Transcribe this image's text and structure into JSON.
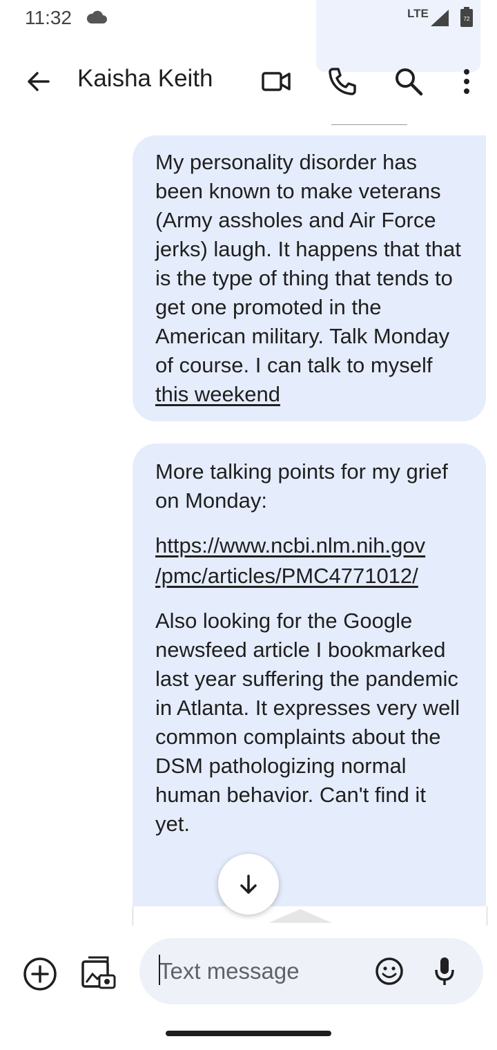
{
  "status_bar": {
    "time": "11:32",
    "network": "LTE",
    "battery_level": "72",
    "icons": [
      "cloud-icon",
      "signal-icon",
      "battery-icon"
    ]
  },
  "header": {
    "contact_name": "Kaisha Keith",
    "icons": [
      "back-arrow-icon",
      "video-call-icon",
      "phone-icon",
      "search-icon",
      "more-vert-icon"
    ]
  },
  "messages": [
    {
      "text_before": "My personality disorder has been known to make veterans (Army assholes and Air Force jerks) laugh. It happens that that is the type of thing that tends to get one promoted in the American military. Talk Monday of course. I can talk to myself ",
      "link_text": "this weekend"
    },
    {
      "intro": "More talking points for my grief on Monday:",
      "link": "https://www.ncbi.nlm.nih.gov\n/pmc/articles/PMC4771012/",
      "body": "Also looking for the Google newsfeed article I bookmarked last year suffering the pandemic in Atlanta. It expresses very well common complaints about the DSM pathologizing normal human behavior. Can't find it yet."
    }
  ],
  "compose": {
    "placeholder": "Text message",
    "icons": [
      "add-circle-icon",
      "gallery-icon",
      "emoji-icon",
      "mic-icon"
    ]
  },
  "colors": {
    "bubble": "#e5ecfb",
    "compose_field": "#eef1f8",
    "text": "#1f1f1f"
  }
}
